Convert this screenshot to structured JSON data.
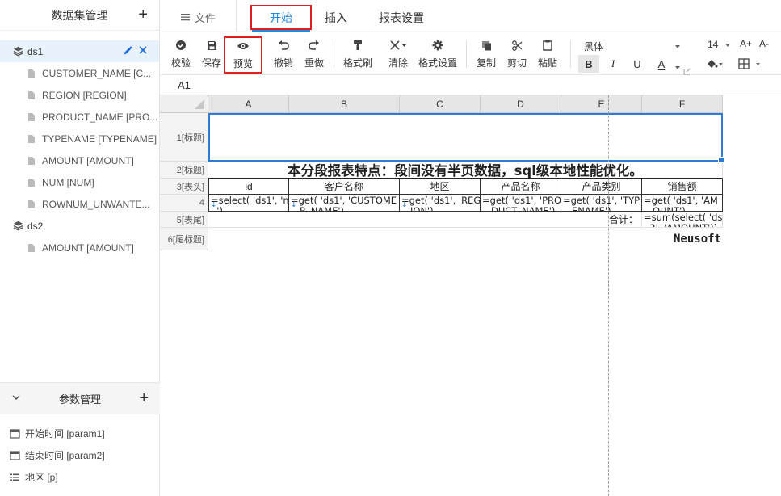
{
  "sidebar": {
    "title": "数据集管理",
    "add_icon": "plus-icon",
    "datasets": [
      {
        "name": "ds1",
        "fields": [
          "CUSTOMER_NAME [C...",
          "REGION [REGION]",
          "PRODUCT_NAME [PRO...",
          "TYPENAME [TYPENAME]",
          "AMOUNT [AMOUNT]",
          "NUM [NUM]",
          "ROWNUM_UNWANTE..."
        ]
      },
      {
        "name": "ds2",
        "fields": [
          "AMOUNT [AMOUNT]"
        ]
      }
    ]
  },
  "params": {
    "title": "参数管理",
    "items": [
      {
        "label": "开始时间 [param1]",
        "icon": "calendar-icon"
      },
      {
        "label": "结束时间 [param2]",
        "icon": "calendar-icon"
      },
      {
        "label": "地区 [p]",
        "icon": "list-icon"
      }
    ]
  },
  "topbar": {
    "menu_label": "文件",
    "tabs": [
      "开始",
      "插入",
      "报表设置"
    ],
    "active_tab": "开始"
  },
  "toolbar": {
    "verify": "校验",
    "save": "保存",
    "preview": "预览",
    "undo": "撤销",
    "redo": "重做",
    "format_painter": "格式刷",
    "clear": "清除",
    "format_settings": "格式设置",
    "copy": "复制",
    "cut": "剪切",
    "paste": "粘贴",
    "font_name": "黑体",
    "font_size": "14",
    "font_increase": "A+",
    "font_decrease": "A-",
    "bold": "B",
    "italic": "I",
    "underline": "U",
    "font_color": "A"
  },
  "namebox": {
    "value": "A1"
  },
  "grid": {
    "columns": [
      "A",
      "B",
      "C",
      "D",
      "E",
      "F"
    ],
    "rows": [
      "1[标题]",
      "2[标题]",
      "3[表头]",
      "4",
      "5[表尾]",
      "6[尾标题]"
    ],
    "title_text": "本分段报表特点：段间没有半页数据，sql级本地性能优化。",
    "headers": [
      "id",
      "客户名称",
      "地区",
      "产品名称",
      "产品类别",
      "销售额"
    ],
    "formulas": [
      "=select( 'ds1', 'n\n  ')",
      "=get( 'ds1', 'CUSTOME\n   R_NAME')",
      "=get( 'ds1', 'REG\n   ION')",
      "=get( 'ds1', 'PRO\n   DUCT_NAME')",
      "=get( 'ds1', 'TYP\n   ENAME')",
      "=get( 'ds1', 'AM\n   OUNT')"
    ],
    "total_label": "合计：",
    "total_formula": "=sum(select( 'ds\n  2', 'AMOUNT'))",
    "footer_text": "Neusoft"
  }
}
